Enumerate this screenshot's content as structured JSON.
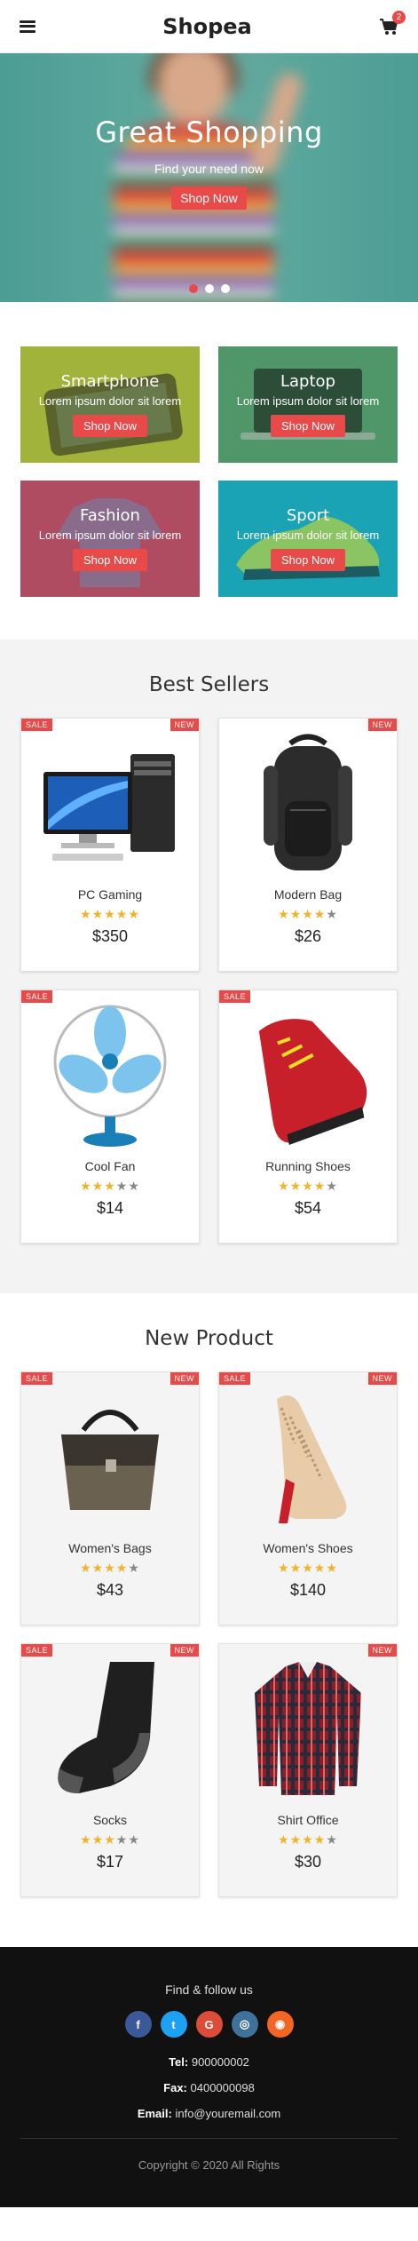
{
  "header": {
    "brand": "Shopea",
    "cart_count": "2"
  },
  "hero": {
    "title": "Great Shopping",
    "subtitle": "Find your need now",
    "button": "Shop Now"
  },
  "categories": [
    {
      "title": "Smartphone",
      "desc": "Lorem ipsum dolor sit lorem",
      "button": "Shop Now",
      "color": "#a2b33b"
    },
    {
      "title": "Laptop",
      "desc": "Lorem ipsum dolor sit lorem",
      "button": "Shop Now",
      "color": "#4f9769"
    },
    {
      "title": "Fashion",
      "desc": "Lorem ipsum dolor sit lorem",
      "button": "Shop Now",
      "color": "#b04c61"
    },
    {
      "title": "Sport",
      "desc": "Lorem ipsum dolor sit lorem",
      "button": "Shop Now",
      "color": "#19a3b4"
    }
  ],
  "best_sellers": {
    "title": "Best Sellers",
    "products": [
      {
        "name": "PC Gaming",
        "price": "$350",
        "rating": 5,
        "sale": "SALE",
        "new": "NEW",
        "icon": "desktop-pc-icon"
      },
      {
        "name": "Modern Bag",
        "price": "$26",
        "rating": 4,
        "sale": "",
        "new": "NEW",
        "icon": "backpack-icon"
      },
      {
        "name": "Cool Fan",
        "price": "$14",
        "rating": 3,
        "sale": "SALE",
        "new": "",
        "icon": "desk-fan-icon"
      },
      {
        "name": "Running Shoes",
        "price": "$54",
        "rating": 4,
        "sale": "SALE",
        "new": "",
        "icon": "running-shoe-icon"
      }
    ]
  },
  "new_products": {
    "title": "New Product",
    "products": [
      {
        "name": "Women's Bags",
        "price": "$43",
        "rating": 4,
        "sale": "SALE",
        "new": "NEW",
        "icon": "handbag-icon"
      },
      {
        "name": "Women's Shoes",
        "price": "$140",
        "rating": 5,
        "sale": "SALE",
        "new": "NEW",
        "icon": "high-heel-icon"
      },
      {
        "name": "Socks",
        "price": "$17",
        "rating": 3,
        "sale": "SALE",
        "new": "NEW",
        "icon": "sock-icon"
      },
      {
        "name": "Shirt Office",
        "price": "$30",
        "rating": 4,
        "sale": "",
        "new": "NEW",
        "icon": "plaid-shirt-icon"
      }
    ]
  },
  "footer": {
    "follow": "Find & follow us",
    "socials": [
      {
        "icon": "facebook-icon",
        "glyph": "f",
        "color": "#3b5998"
      },
      {
        "icon": "twitter-icon",
        "glyph": "t",
        "color": "#1da1f2"
      },
      {
        "icon": "google-plus-icon",
        "glyph": "G",
        "color": "#dd4b39"
      },
      {
        "icon": "instagram-icon",
        "glyph": "◎",
        "color": "#3f729b"
      },
      {
        "icon": "rss-icon",
        "glyph": "◉",
        "color": "#f26522"
      }
    ],
    "tel_label": "Tel:",
    "tel": "900000002",
    "fax_label": "Fax:",
    "fax": "0400000098",
    "email_label": "Email:",
    "email": "info@youremail.com",
    "copyright": "Copyright © 2020 All Rights"
  },
  "colors": {
    "accent": "#e84a4a",
    "star": "#f0b429",
    "footer_bg": "#111111"
  }
}
